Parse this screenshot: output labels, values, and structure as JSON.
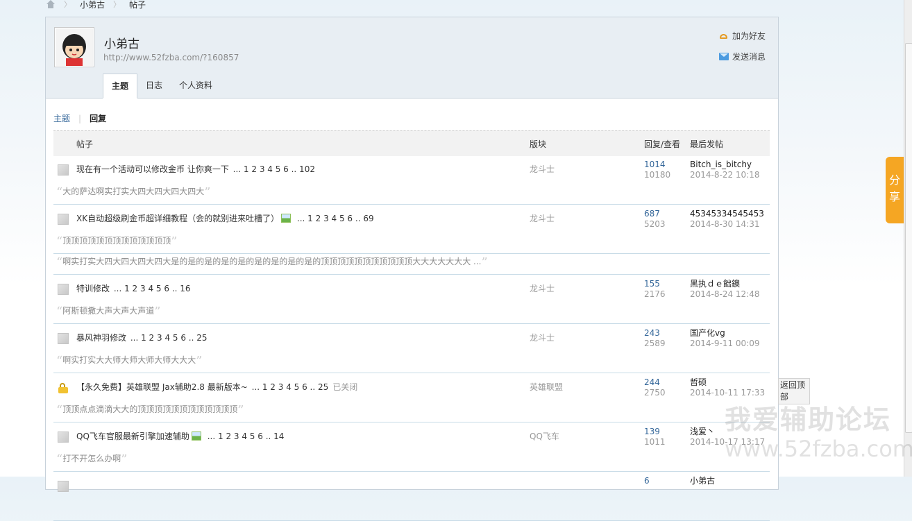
{
  "breadcrumb": [
    "小弟古",
    "帖子"
  ],
  "profile": {
    "name": "小弟古",
    "url": "http://www.52fzba.com/?160857",
    "add_friend": "加为好友",
    "send_message": "发送消息"
  },
  "tabs": [
    "主题",
    "日志",
    "个人资料"
  ],
  "subtabs": [
    "主题",
    "回复"
  ],
  "table_headers": {
    "post": "帖子",
    "forum": "版块",
    "counts": "回复/查看",
    "last": "最后发帖"
  },
  "threads": [
    {
      "title": "现在有一个活动可以修改金币 让你爽一下",
      "has_image": false,
      "locked": false,
      "pages": "... 1 2 3 4 5 6 .. 102",
      "forum": "龙斗士",
      "replies": "1014",
      "views": "10180",
      "last_user": "Bitch_is_bitchy",
      "last_time": "2014-8-22 10:18",
      "quotes": [
        "大的萨达啊实打实大四大四大四大四大"
      ]
    },
    {
      "title": "XK自动超级刷金币超详细教程（会的就别进来吐槽了）",
      "has_image": true,
      "locked": false,
      "pages": "... 1 2 3 4 5 6 .. 69",
      "forum": "龙斗士",
      "replies": "687",
      "views": "5203",
      "last_user": "45345334545453",
      "last_time": "2014-8-30 14:31",
      "quotes": [
        "顶顶顶顶顶顶顶顶顶顶顶顶顶",
        "啊实打实大四大四大四大四大是的是的是的是的是的是的是的是的是的顶顶顶顶顶顶顶顶顶顶顶大大大大大大大 ..."
      ]
    },
    {
      "title": "特训修改",
      "has_image": false,
      "locked": false,
      "pages": "... 1 2 3 4 5 6 .. 16",
      "forum": "龙斗士",
      "replies": "155",
      "views": "2176",
      "last_user": "黑执ｄｅ飿鐭",
      "last_time": "2014-8-24 12:48",
      "quotes": [
        "阿斯顿撒大声大声大声道"
      ]
    },
    {
      "title": "暴风神羽修改",
      "has_image": false,
      "locked": false,
      "pages": "... 1 2 3 4 5 6 .. 25",
      "forum": "龙斗士",
      "replies": "243",
      "views": "2589",
      "last_user": "国产化vg",
      "last_time": "2014-9-11 00:09",
      "quotes": [
        "啊实打实大大师大师大师大师大大大"
      ]
    },
    {
      "title": "【永久免费】英雄联盟 Jax辅助2.8 最新版本~",
      "has_image": false,
      "locked": true,
      "pages": "... 1 2 3 4 5 6 .. 25",
      "closed": "已关闭",
      "forum": "英雄联盟",
      "replies": "244",
      "views": "2750",
      "last_user": "哲硕",
      "last_time": "2014-10-11 17:33",
      "quotes": [
        "顶顶点点滴滴大大的顶顶顶顶顶顶顶顶顶顶顶顶"
      ]
    },
    {
      "title": "QQ飞车官服最新引擎加速辅助",
      "has_image": true,
      "locked": false,
      "pages": "... 1 2 3 4 5 6 .. 14",
      "forum": "QQ飞车",
      "replies": "139",
      "views": "1011",
      "last_user": "浅爱丶",
      "last_time": "2014-10-17 13:17",
      "quotes": [
        "打不开怎么办啊"
      ]
    },
    {
      "title": "",
      "has_image": false,
      "locked": false,
      "pages": "",
      "forum": "",
      "replies": "6",
      "views": "",
      "last_user": "小弟古",
      "last_time": "",
      "quotes": []
    }
  ],
  "share_label": "分享",
  "back_to_top": "返回顶部",
  "watermark": {
    "cn": "我爱辅助论坛",
    "url": "www.52fzba.com"
  }
}
